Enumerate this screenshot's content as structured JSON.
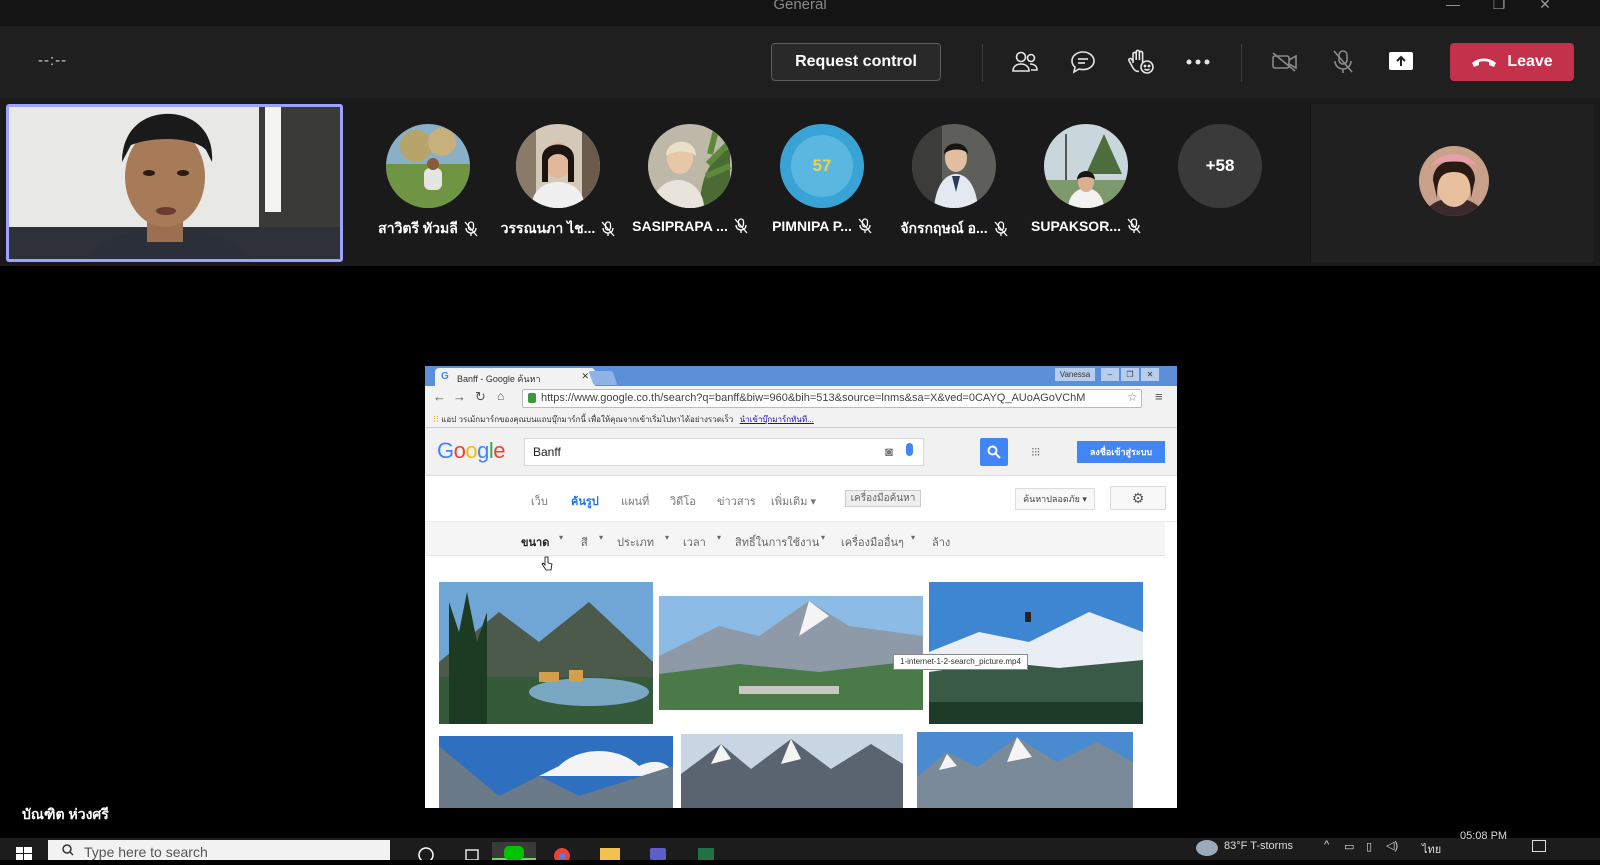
{
  "window": {
    "title": "General"
  },
  "toolbar": {
    "timer": "--:--",
    "request_control_label": "Request control",
    "leave_label": "Leave",
    "colors": {
      "leave": "#c4314b",
      "self_border": "#9ea2ff"
    },
    "icons": [
      "participants-icon",
      "chat-icon",
      "raise-hand-icon",
      "more-options-icon",
      "camera-off-icon",
      "mic-off-icon",
      "share-tray-icon",
      "hang-up-icon"
    ]
  },
  "participants": [
    {
      "name": "สาวิตรี ทัวมลี",
      "muted": true,
      "avatar_color": "#7a9a5a"
    },
    {
      "name": "วรรณนภา ไช...",
      "muted": true,
      "avatar_color": "#c9a99a"
    },
    {
      "name": "SASIPRAPA ...",
      "muted": true,
      "avatar_color": "#7d8a6a"
    },
    {
      "name": "PIMNIPA P...",
      "muted": true,
      "initials": "57",
      "avatar_color": "#3aa3d6"
    },
    {
      "name": "จักรกฤษณ์ อ...",
      "muted": true,
      "avatar_color": "#6b6b6b"
    },
    {
      "name": "SUPAKSOR...",
      "muted": true,
      "avatar_color": "#8fa38c"
    }
  ],
  "more_participants": "+58",
  "presenter_name": "บัณฑิต ห่วงศรี",
  "shared_screen": {
    "tab_title": "Banff - Google ค้นหา",
    "chrome_user": "Vanessa",
    "url": "https://www.google.co.th/search?q=banff&biw=960&bih=513&source=lnms&sa=X&ved=0CAYQ_AUoAGoVChM",
    "bookmarks_text": "แอป  วรเม้กมาร์กของคุณบนแถบบุ๊กมาร์กนี้ เพื่อให้คุณจากเข้าเริ่มไปหาได้อย่างรวดเร็ว",
    "bookmarks_link": "นำเข้าบุ๊กมาร์กทันที...",
    "logo": "Google",
    "query": "Banff",
    "signin_label": "ลงชื่อเข้าสู่ระบบ",
    "tabs": [
      "เว็บ",
      "ค้นรูป",
      "แผนที่",
      "วิดีโอ",
      "ข่าวสาร",
      "เพิ่มเติม ▾"
    ],
    "active_tab": "ค้นรูป",
    "search_tools_label": "เครื่องมือค้นหา",
    "safe_search_label": "ค้นหาปลอดภัย ▾",
    "filters": [
      "ขนาด",
      "สี",
      "ประเภท",
      "เวลา",
      "สิทธิ์ในการใช้งาน",
      "เครื่องมืออื่นๆ",
      "ล้าง"
    ],
    "tooltip": "1-internet-1-2-search_picture.mp4"
  },
  "taskbar": {
    "search_placeholder": "Type here to search",
    "weather": "83°F  T-storms",
    "lang": "ไทย",
    "time": "05:08 PM"
  }
}
